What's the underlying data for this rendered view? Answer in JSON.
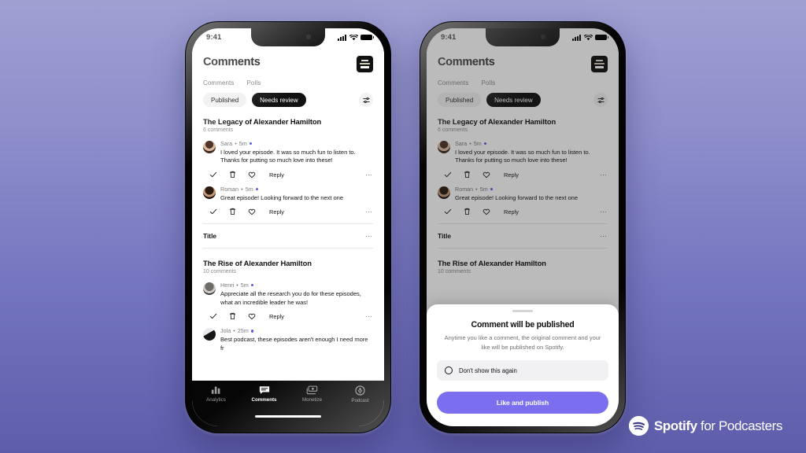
{
  "background": {
    "gradient_top": "#9fa0d2",
    "gradient_bottom": "#5d5dab"
  },
  "brand": {
    "name": "Spotify",
    "suffix": " for Podcasters",
    "mark": "spotify-logo-icon",
    "accent": "#7b6ff0"
  },
  "status_bar": {
    "time": "9:41",
    "signal": "signal-icon",
    "wifi": "wifi-icon",
    "battery": "battery-icon"
  },
  "app": {
    "header": {
      "title": "Comments",
      "cover_art": "podcast-cover-art"
    },
    "sub_tabs": [
      {
        "label": "Comments",
        "active": true
      },
      {
        "label": "Polls",
        "active": false
      }
    ],
    "filter_chips": [
      {
        "label": "Published",
        "active": false
      },
      {
        "label": "Needs review",
        "active": true
      }
    ],
    "filter_button": "filter-sliders-icon",
    "episodes": [
      {
        "title": "The Legacy of Alexander Hamilton",
        "comment_count": "6 comments",
        "comments": [
          {
            "author": "Sara",
            "time": "5m",
            "unread": true,
            "text": "I loved your episode. It was so much fun to listen to. Thanks for putting so much love into these!",
            "actions": {
              "approve": "check-icon",
              "delete": "trash-icon",
              "like": "heart-icon",
              "reply": "Reply",
              "more": "ellipsis-icon"
            }
          },
          {
            "author": "Roman",
            "time": "5m",
            "unread": true,
            "text": "Great episode! Looking forward to the next one",
            "actions": {
              "approve": "check-icon",
              "delete": "trash-icon",
              "like": "heart-icon",
              "reply": "Reply",
              "more": "ellipsis-icon"
            }
          }
        ]
      },
      {
        "section_label": "Title",
        "title": "The Rise of Alexander Hamilton",
        "comment_count": "10 comments",
        "comments": [
          {
            "author": "Henri",
            "time": "5m",
            "unread": true,
            "text": "Appreciate all the research you do for these episodes, what an incredible leader he was!",
            "actions": {
              "approve": "check-icon",
              "delete": "trash-icon",
              "like": "heart-icon",
              "reply": "Reply",
              "more": "ellipsis-icon"
            }
          },
          {
            "author": "Jola",
            "time": "25m",
            "unread": true,
            "text": "Best podcast, these episodes aren't enough I need more fr",
            "actions": {}
          }
        ]
      }
    ],
    "tab_bar": [
      {
        "label": "Analytics",
        "icon": "bar-chart-icon",
        "active": false
      },
      {
        "label": "Comments",
        "icon": "speech-bubble-icon",
        "active": true
      },
      {
        "label": "Monetize",
        "icon": "money-icon",
        "active": false
      },
      {
        "label": "Podcast",
        "icon": "microphone-broadcast-icon",
        "active": false
      }
    ]
  },
  "modal": {
    "title": "Comment will be published",
    "body": "Anytime you like a comment, the original comment and your like will be published on Spotify.",
    "checkbox_label": "Don't show this again",
    "cta_label": "Like and publish"
  }
}
